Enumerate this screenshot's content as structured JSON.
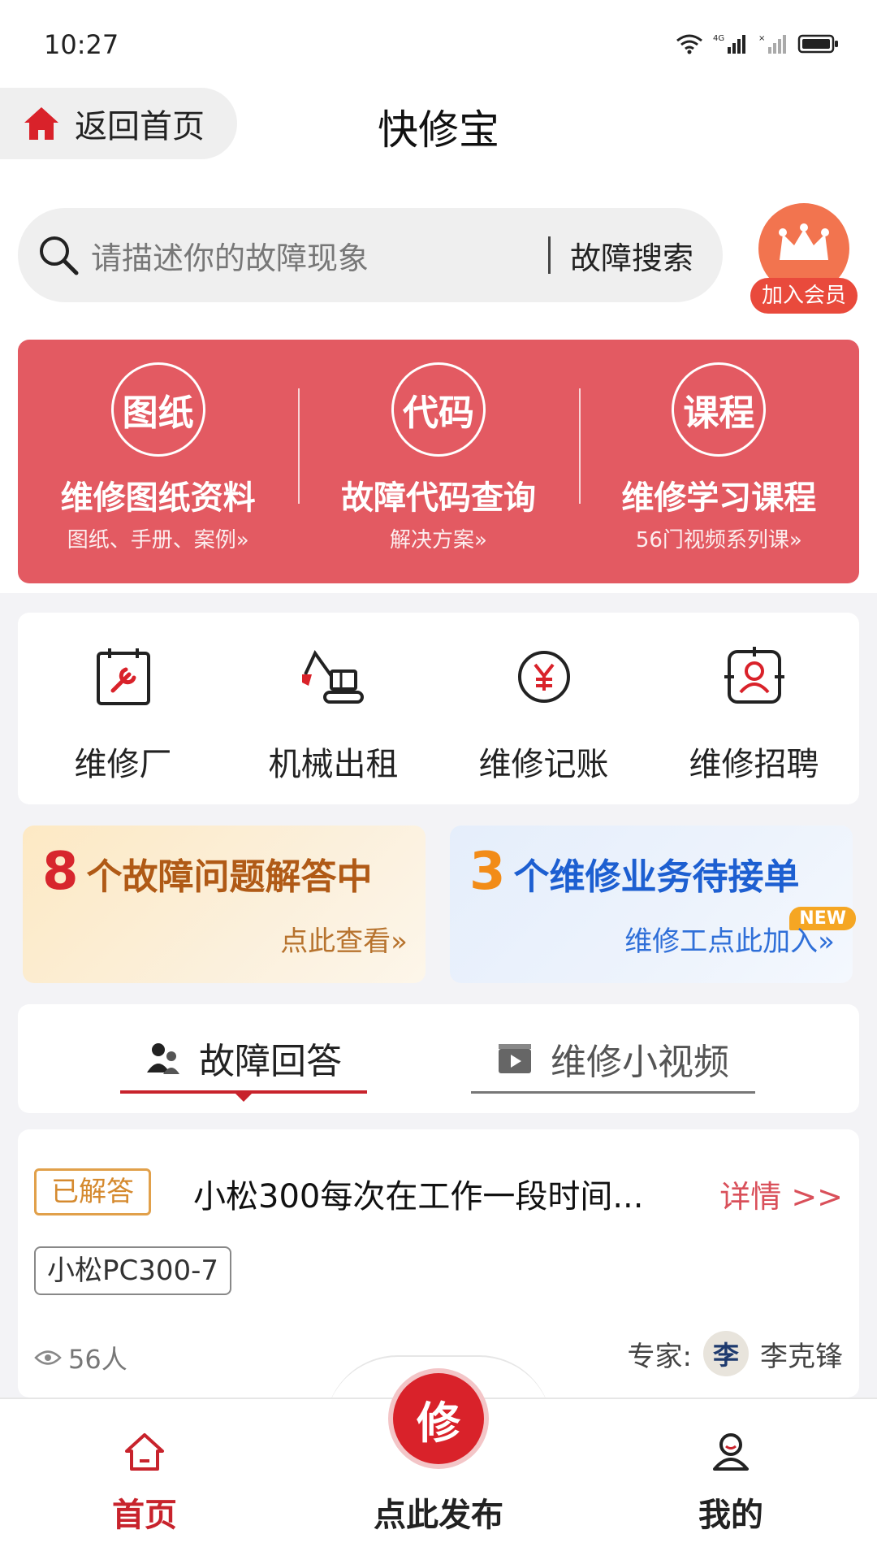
{
  "status_bar": {
    "time": "10:27"
  },
  "header": {
    "back_home_label": "返回首页",
    "title": "快修宝"
  },
  "search": {
    "placeholder": "请描述你的故障现象",
    "button_label": "故障搜索"
  },
  "vip": {
    "label": "加入会员"
  },
  "services": [
    {
      "badge": "图纸",
      "title": "维修图纸资料",
      "subtitle": "图纸、手册、案例»"
    },
    {
      "badge": "代码",
      "title": "故障代码查询",
      "subtitle": "解决方案»"
    },
    {
      "badge": "课程",
      "title": "维修学习课程",
      "subtitle": "56门视频系列课»"
    }
  ],
  "features": [
    {
      "label": "维修厂",
      "icon": "repair-shop-icon"
    },
    {
      "label": "机械出租",
      "icon": "excavator-icon"
    },
    {
      "label": "维修记账",
      "icon": "yuan-icon"
    },
    {
      "label": "维修招聘",
      "icon": "recruit-icon"
    }
  ],
  "promos": {
    "questions": {
      "count": "8",
      "text": "个故障问题解答中",
      "link": "点此查看»"
    },
    "orders": {
      "count": "3",
      "text": "个维修业务待接单",
      "link": "维修工点此加入»",
      "badge": "NEW"
    }
  },
  "tabs": {
    "answers": "故障回答",
    "videos": "维修小视频"
  },
  "question_card": {
    "status": "已解答",
    "title": "小松300每次在工作一段时间...",
    "detail": "详情 >>",
    "tag": "小松PC300-7",
    "views": "56人",
    "expert_label": "专家:",
    "expert_avatar": "李",
    "expert_name": "李克锋"
  },
  "bottom_nav": {
    "home": "首页",
    "publish_icon_text": "修",
    "publish": "点此发布",
    "mine": "我的"
  },
  "colors": {
    "brand_red": "#d9222a",
    "panel_red": "#e35a62",
    "orange": "#f28c18",
    "blue": "#1d5fd1"
  }
}
